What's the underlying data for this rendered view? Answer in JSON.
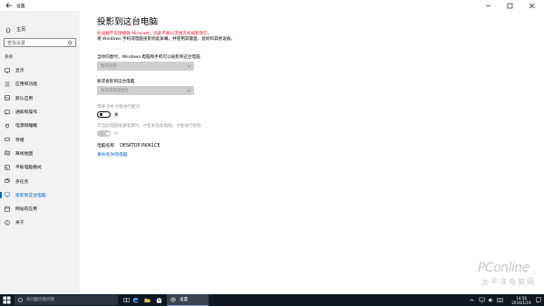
{
  "window": {
    "title": "设置"
  },
  "sidebar": {
    "home_label": "主页",
    "search_placeholder": "查找设置",
    "section_label": "系统",
    "items": [
      {
        "label": "显示",
        "icon": "display-icon"
      },
      {
        "label": "应用和功能",
        "icon": "apps-icon"
      },
      {
        "label": "默认应用",
        "icon": "default-apps-icon"
      },
      {
        "label": "通知和操作",
        "icon": "notifications-icon"
      },
      {
        "label": "电源和睡眠",
        "icon": "power-icon"
      },
      {
        "label": "存储",
        "icon": "storage-icon"
      },
      {
        "label": "离线地图",
        "icon": "offline-maps-icon"
      },
      {
        "label": "平板电脑模式",
        "icon": "tablet-mode-icon"
      },
      {
        "label": "多任务",
        "icon": "multitasking-icon"
      },
      {
        "label": "投影到这台电脑",
        "icon": "project-icon",
        "active": true
      },
      {
        "label": "网站的应用",
        "icon": "apps-for-websites-icon"
      },
      {
        "label": "关于",
        "icon": "about-icon"
      }
    ],
    "accent_color": "#0067c0"
  },
  "main": {
    "title": "投影到这台电脑",
    "warning": "此设备不支持接收 Miracast，因此不能以无线方式投影到它。",
    "description": "将 Windows 手机或电脑投影到此屏幕，并使用其键盘、鼠标和其他设备。",
    "setting1_label": "当你同意时，Windows 电脑和手机可以投影到这台电脑",
    "setting1_value": "始终关闭",
    "setting2_label": "要求投影到这台电脑",
    "setting2_value": "每次请求连接时",
    "pin_label": "需要 PIN 才能进行配对",
    "pin_toggle": "关",
    "power_label": "仅当此电脑接通电源时，才能发现此电脑，才能进行投影",
    "power_toggle": "开",
    "pc_name_label": "电脑名称",
    "pc_name_value": "DESKTOP-IN061CE",
    "rename_link": "重命名你的电脑",
    "warning_color": "#e81123"
  },
  "watermark": {
    "brand": "PConline",
    "cn": "太平洋电脑网"
  },
  "taskbar": {
    "search_placeholder": "有问题尽管问我",
    "active_app": "设置",
    "time": "14:56",
    "date": "2016/1/19",
    "color": "#0f1722"
  }
}
